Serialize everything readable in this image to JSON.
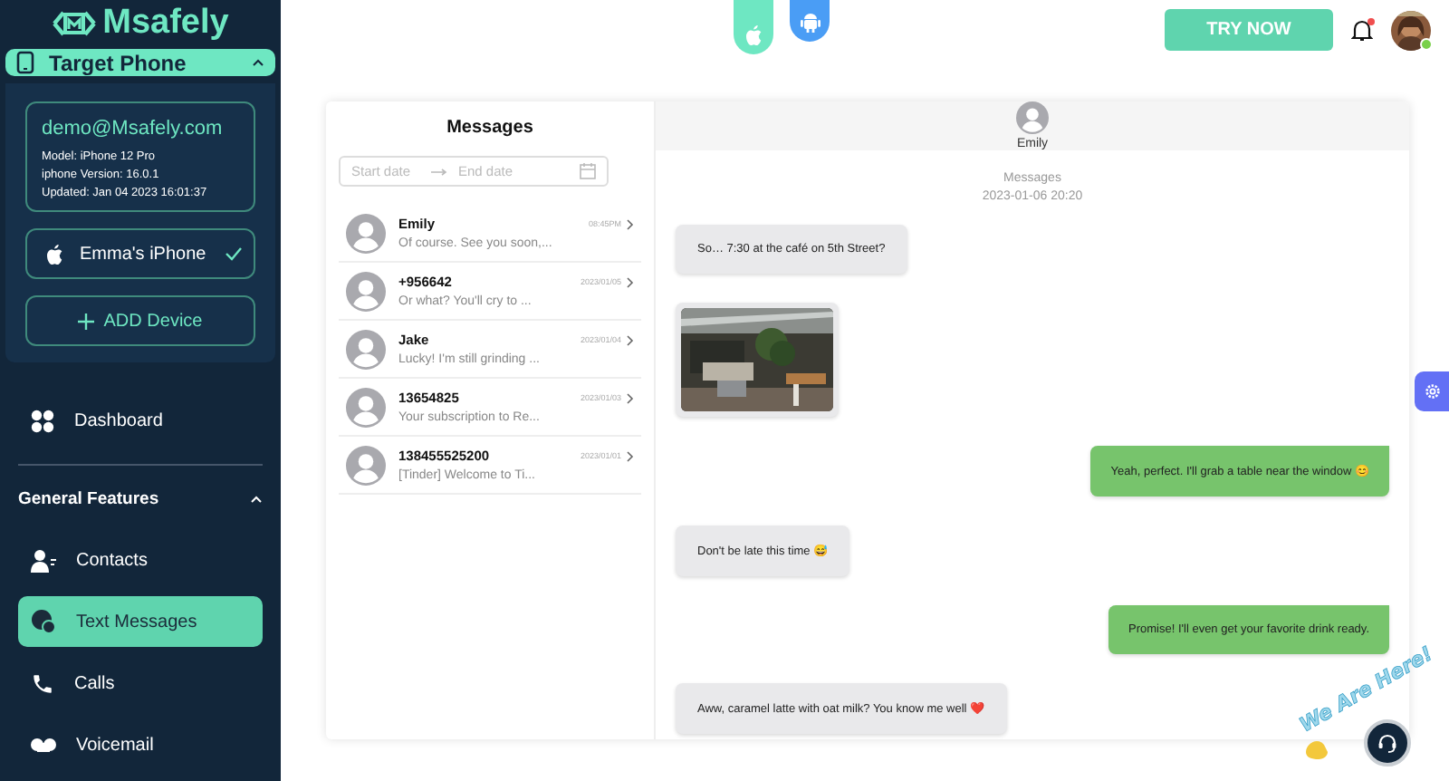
{
  "logo": {
    "name": "Msafely"
  },
  "target_phone": {
    "label": "Target Phone",
    "expanded": true,
    "account": {
      "email": "demo@Msafely.com",
      "details": [
        "Model: iPhone 12 Pro",
        "iphone Version: 16.0.1",
        "Updated: Jan 04 2023 16:01:37"
      ]
    },
    "devices": [
      {
        "name": "Emma's iPhone",
        "selected": true
      }
    ],
    "add_button": "ADD Device"
  },
  "nav": [
    {
      "kind": "dashboard",
      "label": "Dashboard",
      "selected": false
    },
    {
      "kind": "divider"
    },
    {
      "kind": "section",
      "label": "General Features",
      "expanded": true
    },
    {
      "kind": "contacts",
      "label": "Contacts",
      "selected": false
    },
    {
      "kind": "messages",
      "label": "Text Messages",
      "selected": true
    },
    {
      "kind": "calls",
      "label": "Calls",
      "selected": false
    },
    {
      "kind": "voicemail",
      "label": "Voicemail",
      "selected": false
    }
  ],
  "platform_tabs": [
    {
      "kind": "apple",
      "selected": true
    },
    {
      "kind": "android",
      "selected": false
    }
  ],
  "topbar": {
    "try_button": "TRY NOW",
    "notifications_unread": true,
    "online": true
  },
  "messages_panel": {
    "title": "Messages",
    "date_range": {
      "start_placeholder": "Start date",
      "end_placeholder": "End date"
    },
    "conversations": [
      {
        "name": "Emily",
        "preview": "Of course. See you soon,...",
        "time": "08:45PM"
      },
      {
        "name": "+956642",
        "preview": "Or what? You'll cry to ...",
        "time": "2023/01/05"
      },
      {
        "name": "Jake",
        "preview": "Lucky! I'm still grinding ...",
        "time": "2023/01/04"
      },
      {
        "name": "13654825",
        "preview": "Your subscription to Re...",
        "time": "2023/01/03"
      },
      {
        "name": "138455525200",
        "preview": "[Tinder] Welcome to Ti...",
        "time": "2023/01/01"
      }
    ]
  },
  "chat": {
    "contact": "Emily",
    "header_label": "Messages",
    "date": "2023-01-06 20:20",
    "messages": [
      {
        "kind": "received",
        "text": "So… 7:30 at the café on 5th Street?"
      },
      {
        "kind": "picture"
      },
      {
        "kind": "sent",
        "text": "Yeah, perfect. I'll grab a table near the window 😊"
      },
      {
        "kind": "received",
        "text": "Don't be late this time 😅"
      },
      {
        "kind": "sent",
        "text": "Promise! I'll even get your favorite drink ready."
      },
      {
        "kind": "received",
        "text": "Aww, caramel latte with oat milk? You know me well ❤️"
      }
    ]
  },
  "support": {
    "label": "We Are Here!"
  }
}
